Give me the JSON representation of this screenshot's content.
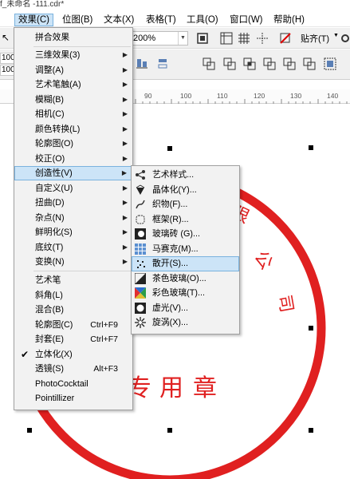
{
  "window": {
    "title": "f_未命名 -111.cdr*"
  },
  "menubar": [
    {
      "label": "效果(C)",
      "active": true
    },
    {
      "label": "位图(B)"
    },
    {
      "label": "文本(X)"
    },
    {
      "label": "表格(T)"
    },
    {
      "label": "工具(O)"
    },
    {
      "label": "窗口(W)"
    },
    {
      "label": "帮助(H)"
    }
  ],
  "toolbar": {
    "zoom_value": "200%",
    "snap_label": "贴齐(T)",
    "coord_x": "100",
    "coord_y": "100"
  },
  "ruler": {
    "ticks": [
      "90",
      "100",
      "110",
      "120",
      "130",
      "140"
    ]
  },
  "effects_menu": {
    "items": [
      {
        "label": "拼合效果",
        "submenu": false
      },
      {
        "label": "三维效果(3)",
        "submenu": true
      },
      {
        "label": "调整(A)",
        "submenu": true
      },
      {
        "label": "艺术笔触(A)",
        "submenu": true
      },
      {
        "label": "模糊(B)",
        "submenu": true
      },
      {
        "label": "相机(C)",
        "submenu": true
      },
      {
        "label": "颜色转换(L)",
        "submenu": true
      },
      {
        "label": "轮廓图(O)",
        "submenu": true
      },
      {
        "label": "校正(O)",
        "submenu": true
      },
      {
        "label": "创造性(V)",
        "submenu": true,
        "highlighted": true
      },
      {
        "label": "自定义(U)",
        "submenu": true
      },
      {
        "label": "扭曲(D)",
        "submenu": true
      },
      {
        "label": "杂点(N)",
        "submenu": true
      },
      {
        "label": "鲜明化(S)",
        "submenu": true
      },
      {
        "label": "底纹(T)",
        "submenu": true
      },
      {
        "label": "变换(N)",
        "submenu": true
      },
      {
        "label": "艺术笔",
        "submenu": false
      },
      {
        "label": "斜角(L)",
        "submenu": false
      },
      {
        "label": "混合(B)",
        "submenu": false
      },
      {
        "label": "轮廓图(C)",
        "shortcut": "Ctrl+F9"
      },
      {
        "label": "封套(E)",
        "shortcut": "Ctrl+F7"
      },
      {
        "label": "立体化(X)",
        "checked": true
      },
      {
        "label": "透镜(S)",
        "shortcut": "Alt+F3"
      },
      {
        "label": "PhotoCocktail"
      },
      {
        "label": "Pointillizer"
      }
    ]
  },
  "creative_submenu": {
    "items": [
      {
        "label": "艺术样式...",
        "icon": "art-style-icon"
      },
      {
        "label": "晶体化(Y)...",
        "icon": "crystallize-icon"
      },
      {
        "label": "织物(F)...",
        "icon": "fabric-icon"
      },
      {
        "label": "框架(R)...",
        "icon": "frame-icon"
      },
      {
        "label": "玻璃砖 (G)...",
        "icon": "glass-block-icon"
      },
      {
        "label": "马赛克(M)...",
        "icon": "mosaic-icon"
      },
      {
        "label": "散开(S)...",
        "icon": "scatter-icon",
        "highlighted": true
      },
      {
        "label": "茶色玻璃(O)...",
        "icon": "smoked-glass-icon"
      },
      {
        "label": "彩色玻璃(T)...",
        "icon": "stained-glass-icon"
      },
      {
        "label": "虚光(V)...",
        "icon": "vignette-icon"
      },
      {
        "label": "旋涡(X)...",
        "icon": "vortex-icon"
      }
    ]
  },
  "stamp": {
    "text_top_right": [
      "限",
      "公",
      "司"
    ],
    "text_bottom": [
      "专",
      "用",
      "章"
    ],
    "color": "#e02020"
  },
  "colors": {
    "highlight": "#cce4f7",
    "highlight_border": "#7ab2de",
    "stamp_red": "#e02020"
  }
}
